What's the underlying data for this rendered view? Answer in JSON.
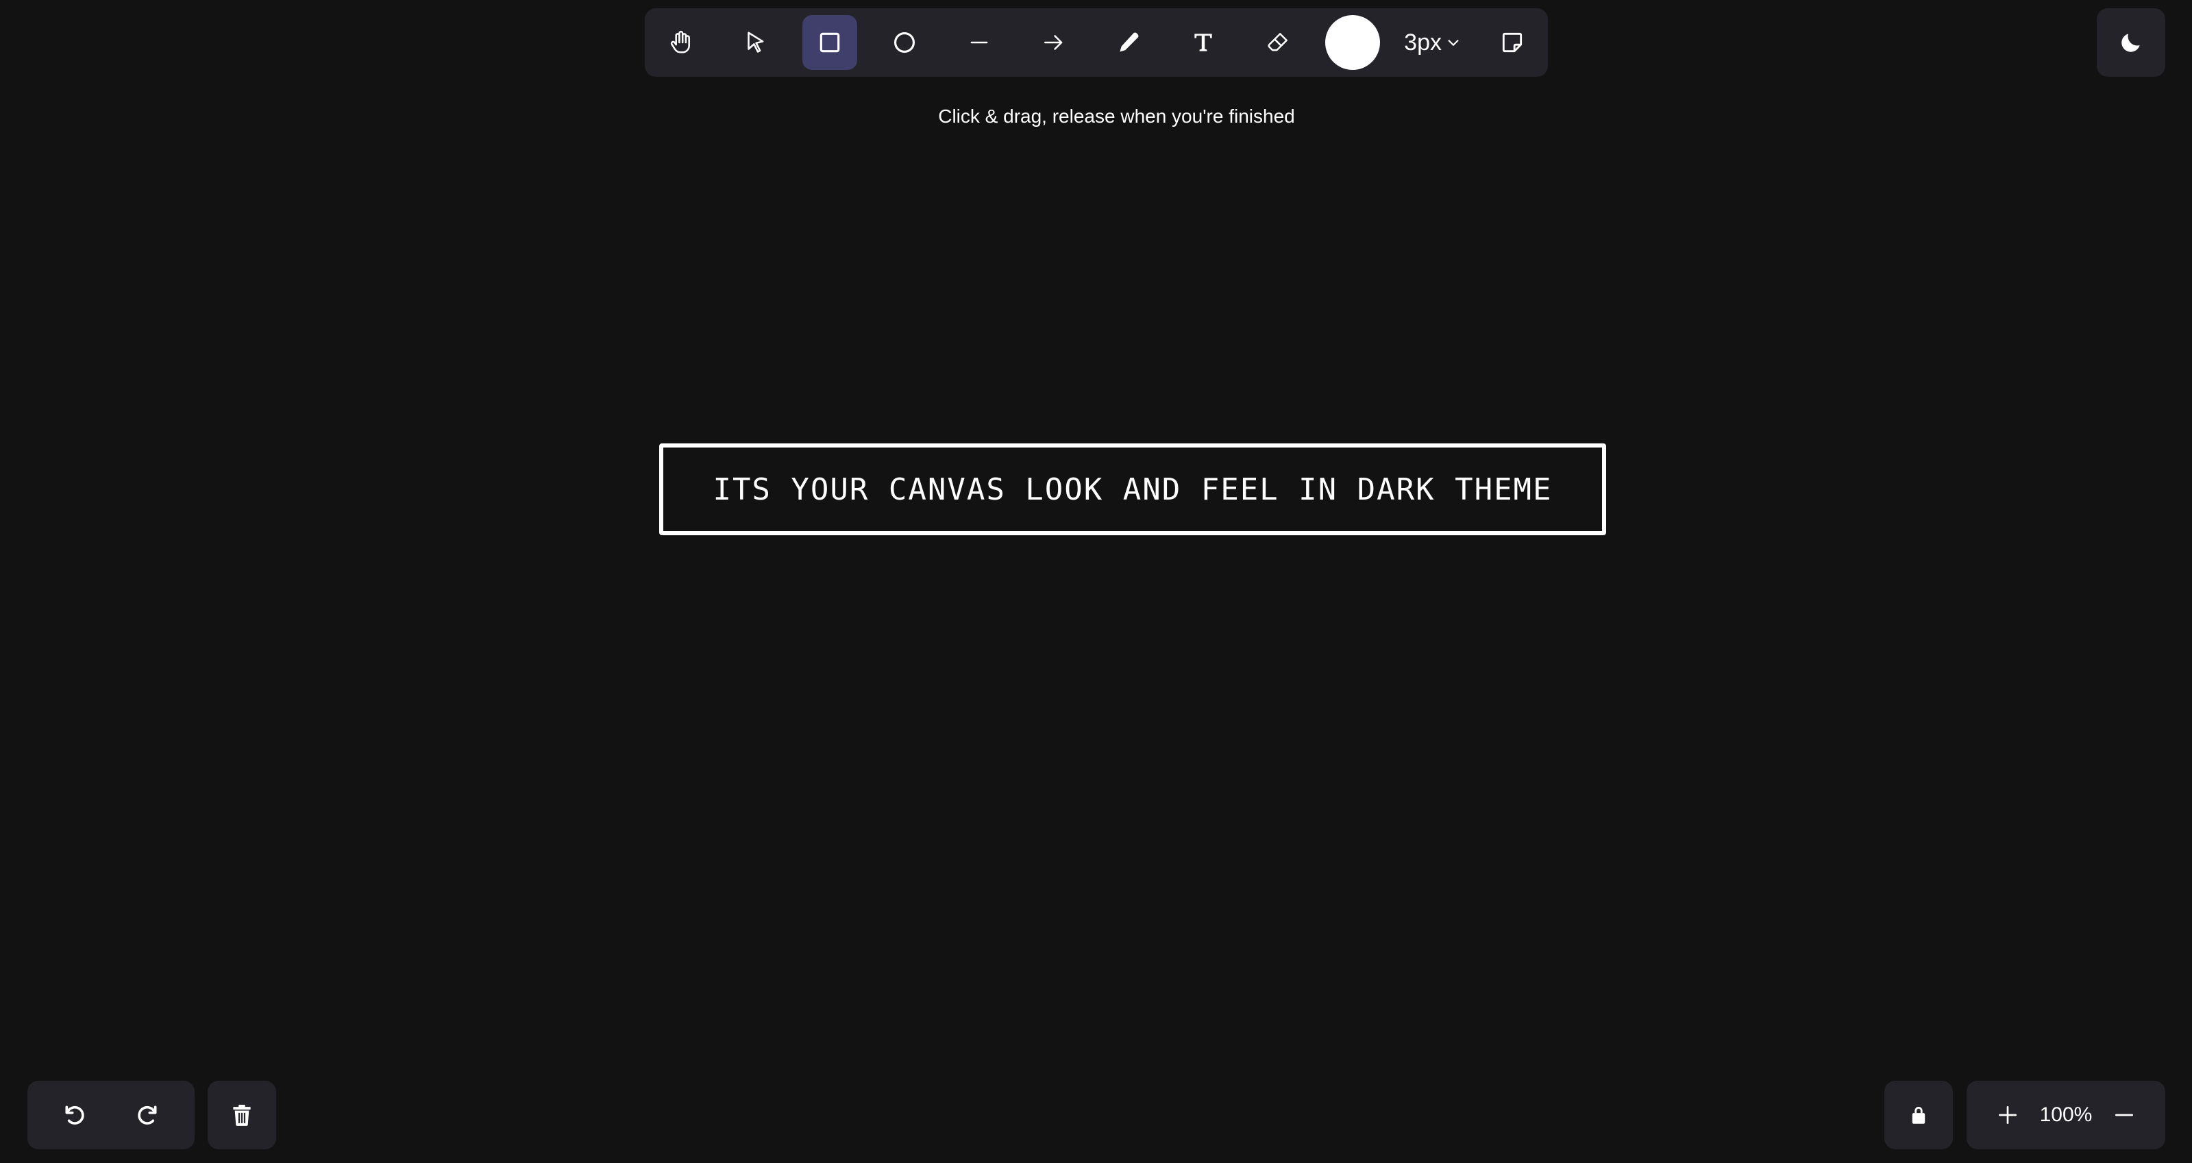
{
  "toolbar": {
    "tools": [
      {
        "name": "hand",
        "icon": "hand-icon"
      },
      {
        "name": "select",
        "icon": "pointer-icon"
      },
      {
        "name": "rectangle",
        "icon": "square-icon",
        "active": true
      },
      {
        "name": "ellipse",
        "icon": "circle-icon"
      },
      {
        "name": "line",
        "icon": "line-icon"
      },
      {
        "name": "arrow",
        "icon": "arrow-right-icon"
      },
      {
        "name": "pencil",
        "icon": "pencil-icon"
      },
      {
        "name": "text",
        "icon": "text-icon"
      },
      {
        "name": "eraser",
        "icon": "eraser-icon"
      }
    ],
    "stroke_color": "#ffffff",
    "stroke_width_label": "3px",
    "sticky_note_icon": "sticky-note-icon"
  },
  "hint": {
    "text": "Click & drag, release when you're finished"
  },
  "theme": {
    "icon": "moon-icon",
    "active_tool_color": "#403e6a",
    "panel_color": "#232329",
    "background_color": "#121212"
  },
  "canvas": {
    "shape_text": "ITS YOUR CANVAS LOOK AND FEEL IN DARK THEME"
  },
  "history": {
    "undo_icon": "undo-icon",
    "redo_icon": "redo-icon",
    "clear_icon": "trash-icon"
  },
  "zoom": {
    "lock_icon": "lock-icon",
    "zoom_in_icon": "plus-icon",
    "level": "100%",
    "zoom_out_icon": "minus-icon"
  }
}
